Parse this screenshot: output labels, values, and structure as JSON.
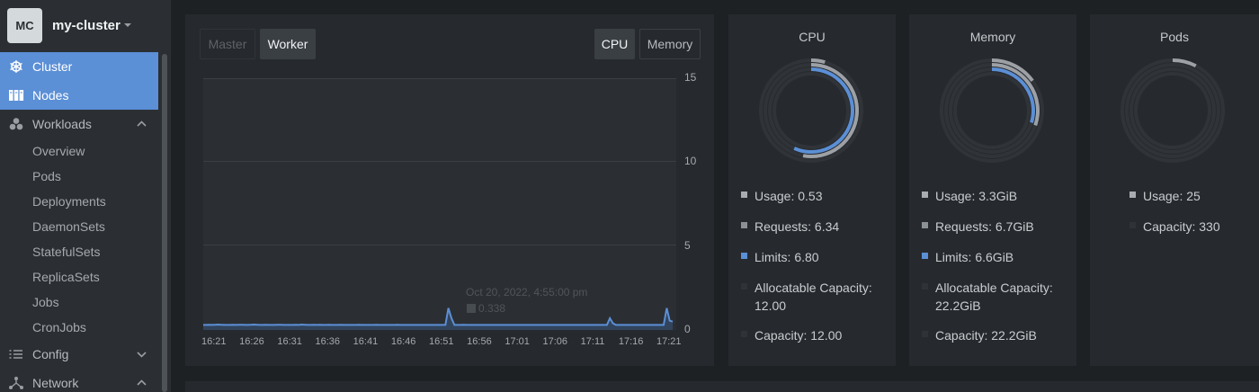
{
  "sidebar": {
    "cluster": {
      "initials": "MC",
      "name": "my-cluster"
    },
    "nav": {
      "cluster": "Cluster",
      "nodes": "Nodes",
      "workloads": "Workloads",
      "config": "Config",
      "network": "Network"
    },
    "workloads_items": [
      "Overview",
      "Pods",
      "Deployments",
      "DaemonSets",
      "StatefulSets",
      "ReplicaSets",
      "Jobs",
      "CronJobs"
    ]
  },
  "chart_panel": {
    "tabs": {
      "master": "Master",
      "worker": "Worker",
      "cpu": "CPU",
      "memory": "Memory"
    },
    "tooltip": {
      "time": "Oct 20, 2022, 4:55:00 pm",
      "value": "0.338"
    }
  },
  "chart_data": {
    "type": "area",
    "series": [
      {
        "values": [
          0.3,
          0.3,
          0.31,
          0.3,
          0.31,
          0.32,
          0.31,
          0.3,
          0.3,
          0.3,
          0.31,
          0.3,
          0.31,
          0.31,
          0.3,
          0.3,
          0.31,
          0.32,
          0.31,
          0.3,
          0.3,
          0.31,
          0.3,
          0.3,
          0.3,
          0.31,
          0.31,
          0.3,
          0.3,
          0.3,
          0.3,
          0.31,
          0.3,
          0.32,
          0.31,
          0.3,
          0.3,
          0.31,
          0.3,
          0.31,
          0.3,
          0.3,
          0.31,
          0.3,
          0.3,
          0.3,
          0.31,
          0.3,
          0.3,
          0.3,
          0.3,
          0.3,
          0.31,
          0.3,
          0.3,
          0.3,
          0.3,
          0.3,
          0.31,
          0.3,
          0.3,
          0.3,
          0.3,
          0.3,
          0.3,
          0.31,
          0.3,
          0.3,
          0.3,
          0.3,
          0.3,
          0.3,
          0.3,
          0.3,
          0.3,
          0.3,
          0.3,
          0.3,
          0.3,
          0.3,
          0.3,
          0.3,
          1.3,
          0.7,
          0.3,
          0.3,
          0.3,
          0.31,
          0.3,
          0.3,
          0.3,
          0.3,
          0.3,
          0.3,
          0.3,
          0.3,
          0.3,
          0.3,
          0.3,
          0.3,
          0.3,
          0.3,
          0.3,
          0.3,
          0.3,
          0.3,
          0.3,
          0.3,
          0.3,
          0.3,
          0.3,
          0.3,
          0.3,
          0.3,
          0.3,
          0.3,
          0.3,
          0.3,
          0.3,
          0.3,
          0.3,
          0.3,
          0.3,
          0.3,
          0.3,
          0.3,
          0.3,
          0.3,
          0.3,
          0.3,
          0.3,
          0.3,
          0.3,
          0.3,
          0.3,
          0.3,
          0.7,
          0.4,
          0.3,
          0.3,
          0.3,
          0.3,
          0.3,
          0.3,
          0.3,
          0.3,
          0.3,
          0.3,
          0.3,
          0.3,
          0.3,
          0.3,
          0.3,
          0.3,
          0.3,
          1.3,
          0.55,
          0.5
        ]
      }
    ],
    "x": [
      "16:21",
      "16:26",
      "16:31",
      "16:36",
      "16:41",
      "16:46",
      "16:51",
      "16:56",
      "17:01",
      "17:06",
      "17:11",
      "17:16",
      "17:21"
    ],
    "yticks": [
      "0",
      "5",
      "10",
      "15"
    ],
    "ylim": [
      0,
      15
    ],
    "grid": true,
    "color": "#5b8fd6"
  },
  "stats": {
    "cpu": {
      "title": "CPU",
      "rings": {
        "usage": 0.044,
        "requests": 0.528,
        "limits": 0.567
      },
      "legend": [
        {
          "label": "Usage: 0.53",
          "color": "#a9adb1"
        },
        {
          "label": "Requests: 6.34",
          "color": "#8c9196"
        },
        {
          "label": "Limits: 6.80",
          "color": "#5b8fd6"
        },
        {
          "label": "Allocatable Capacity: 12.00",
          "color": "#2f3337"
        },
        {
          "label": "Capacity: 12.00",
          "color": "#2f3337"
        }
      ]
    },
    "memory": {
      "title": "Memory",
      "rings": {
        "usage": 0.149,
        "requests": 0.302,
        "limits": 0.297
      },
      "legend": [
        {
          "label": "Usage: 3.3GiB",
          "color": "#a9adb1"
        },
        {
          "label": "Requests: 6.7GiB",
          "color": "#8c9196"
        },
        {
          "label": "Limits: 6.6GiB",
          "color": "#5b8fd6"
        },
        {
          "label": "Allocatable Capacity: 22.2GiB",
          "color": "#2f3337"
        },
        {
          "label": "Capacity: 22.2GiB",
          "color": "#2f3337"
        }
      ]
    },
    "pods": {
      "title": "Pods",
      "rings": {
        "usage": 0.076
      },
      "legend": [
        {
          "label": "Usage: 25",
          "color": "#a9adb1"
        },
        {
          "label": "Capacity: 330",
          "color": "#2f3337"
        }
      ]
    }
  }
}
